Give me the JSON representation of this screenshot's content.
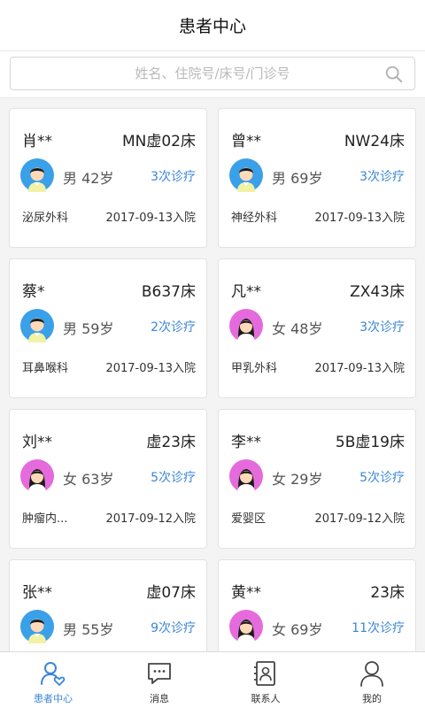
{
  "header": {
    "title": "患者中心"
  },
  "search": {
    "placeholder": "姓名、住院号/床号/门诊号"
  },
  "patients": [
    {
      "name": "肖**",
      "bed": "MN虚02床",
      "gender": "男",
      "age": "42岁",
      "visits": "3次诊疗",
      "dept": "泌尿外科",
      "date": "2017-09-13入院",
      "avatar": "male-avatar-icon"
    },
    {
      "name": "曾**",
      "bed": "NW24床",
      "gender": "男",
      "age": "69岁",
      "visits": "3次诊疗",
      "dept": "神经外科",
      "date": "2017-09-13入院",
      "avatar": "male-avatar-icon"
    },
    {
      "name": "蔡*",
      "bed": "B637床",
      "gender": "男",
      "age": "59岁",
      "visits": "2次诊疗",
      "dept": "耳鼻喉科",
      "date": "2017-09-13入院",
      "avatar": "male-avatar-icon"
    },
    {
      "name": "凡**",
      "bed": "ZX43床",
      "gender": "女",
      "age": "48岁",
      "visits": "3次诊疗",
      "dept": "甲乳外科",
      "date": "2017-09-13入院",
      "avatar": "female-avatar-icon"
    },
    {
      "name": "刘**",
      "bed": "虚23床",
      "gender": "女",
      "age": "63岁",
      "visits": "5次诊疗",
      "dept": "肿瘤内...",
      "date": "2017-09-12入院",
      "avatar": "female-avatar-icon"
    },
    {
      "name": "李**",
      "bed": "5B虚19床",
      "gender": "女",
      "age": "29岁",
      "visits": "5次诊疗",
      "dept": "爱婴区",
      "date": "2017-09-12入院",
      "avatar": "female-avatar-icon"
    },
    {
      "name": "张**",
      "bed": "虚07床",
      "gender": "男",
      "age": "55岁",
      "visits": "9次诊疗",
      "dept": "",
      "date": "",
      "avatar": "male-avatar-icon"
    },
    {
      "name": "黄**",
      "bed": "23床",
      "gender": "女",
      "age": "69岁",
      "visits": "11次诊疗",
      "dept": "",
      "date": "",
      "avatar": "female-avatar-icon"
    }
  ],
  "tabs": [
    {
      "label": "患者中心",
      "icon": "patient-center-icon",
      "active": true
    },
    {
      "label": "消息",
      "icon": "message-icon",
      "active": false
    },
    {
      "label": "联系人",
      "icon": "contacts-icon",
      "active": false
    },
    {
      "label": "我的",
      "icon": "profile-icon",
      "active": false
    }
  ],
  "colors": {
    "accent": "#3a86d8",
    "male_avatar_bg": "#3aa0e8",
    "female_avatar_bg": "#e56bdc"
  }
}
